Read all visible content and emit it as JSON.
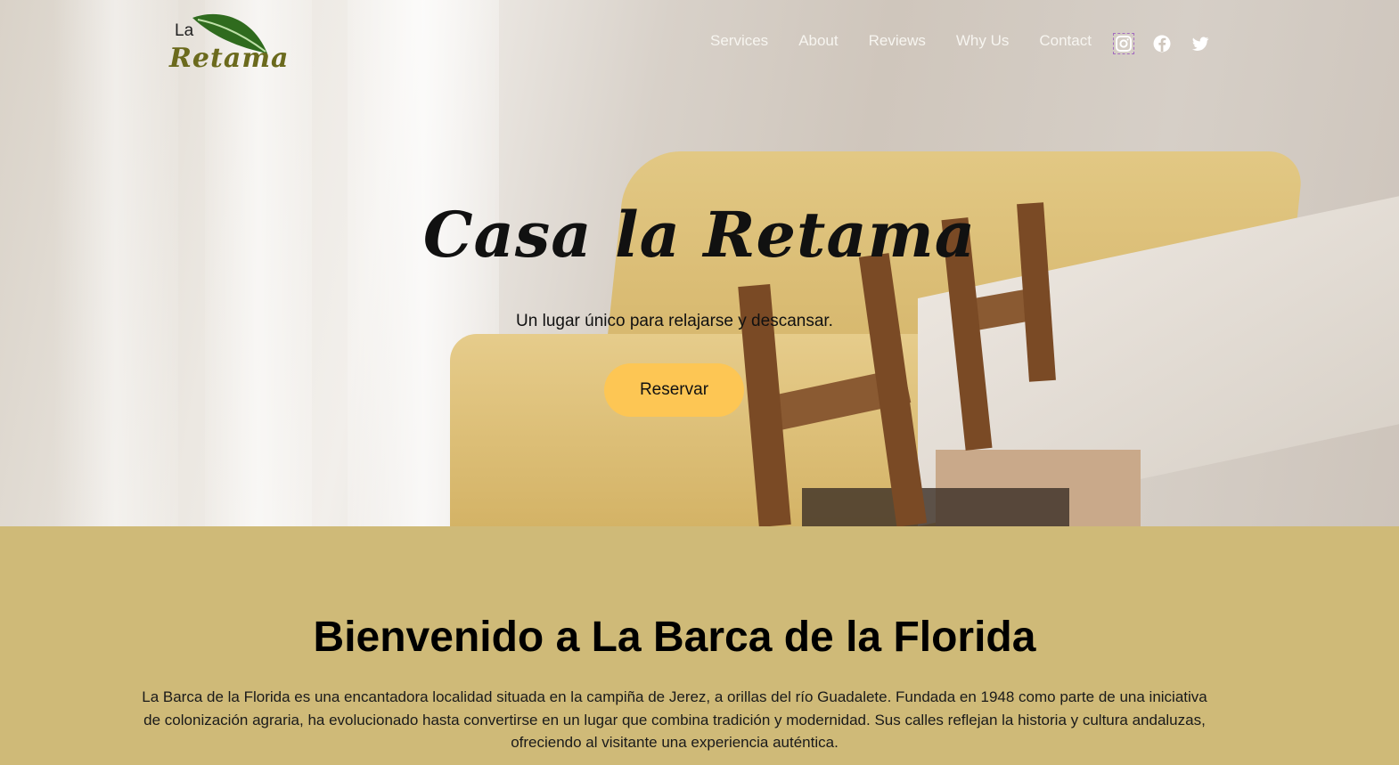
{
  "logo": {
    "small": "La",
    "word": "Retama"
  },
  "nav": {
    "items": [
      "Services",
      "About",
      "Reviews",
      "Why Us",
      "Contact"
    ]
  },
  "social": [
    "instagram-icon",
    "facebook-icon",
    "twitter-icon"
  ],
  "hero": {
    "title": "Casa la Retama",
    "subtitle": "Un lugar único para relajarse y descansar.",
    "button": "Reservar"
  },
  "welcome": {
    "title": "Bienvenido a La Barca de la Florida",
    "text": "La Barca de la Florida es una encantadora localidad situada en la campiña de Jerez, a orillas del río Guadalete. Fundada en 1948 como parte de una iniciativa de colonización agraria, ha evolucionado hasta convertirse en un lugar que combina tradición y modernidad. Sus calles reflejan la historia y cultura andaluzas, ofreciendo al visitante una experiencia auténtica."
  },
  "colors": {
    "button": "#fdc654",
    "section_bg": "#cfba78",
    "logo_leaf": "#2f6b1e",
    "logo_text": "#6b6a1d"
  }
}
